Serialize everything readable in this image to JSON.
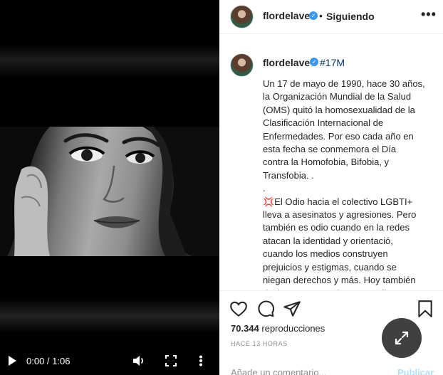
{
  "video": {
    "time": "0:00 / 1:06",
    "icons": [
      "play-icon",
      "volume-icon",
      "fullscreen-icon",
      "more-vertical-icon"
    ]
  },
  "header": {
    "username": "flordelave",
    "separator": "•",
    "follow_status": "Siguiendo",
    "more": "•••"
  },
  "post": {
    "username": "flordelave",
    "hashtag": "#17M",
    "caption": "Un 17 de mayo de 1990, hace 30 años,\nla Organización Mundial de la Salud\n(OMS) quitó la homosexualidad de la\nClasificación Internacional de\nEnfermedades. Por eso cada año en\nesta fecha se conmemora el Día\ncontra la Homofobia, Bifobia, y\nTransfobia. .\n.\n💢El Odio hacia el colectivo LGBTI+\nlleva a asesinatos y agresiones. Pero\ntambién es odio cuando en la redes\natacan la identidad y orientació,\ncuando los medios construyen\nprejuicios y estigmas, cuando se\nniegan derechos y más. Hoy también\ndecimos : ¡Basta de LGBTIodio! ."
  },
  "stats": {
    "views_count": "70.344",
    "views_label": "reproducciones",
    "time_ago": "HACE 13 HORAS"
  },
  "comment": {
    "placeholder": "Añade un comentario...",
    "publish": "Publicar"
  },
  "colors": {
    "accent": "#3897f0",
    "hashtag": "#00376b",
    "muted": "#8e8e8e",
    "publish_disabled": "#b2dffc"
  }
}
